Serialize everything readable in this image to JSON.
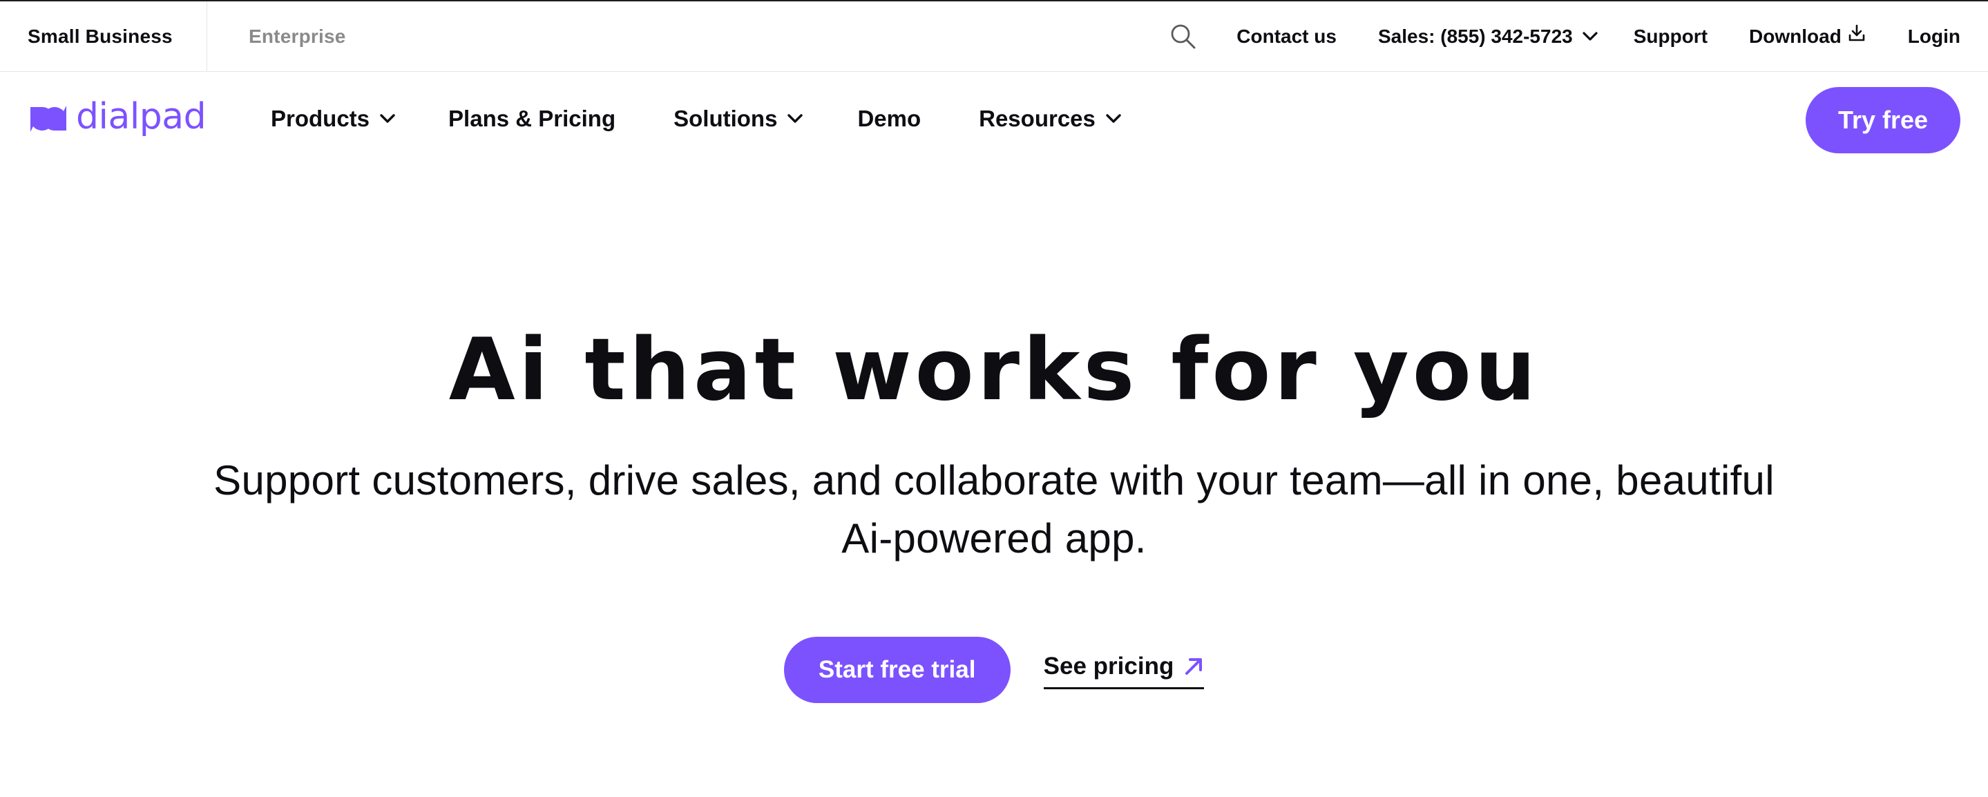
{
  "utility_bar": {
    "segments": [
      "Small Business",
      "Enterprise"
    ],
    "contact": "Contact us",
    "sales": "Sales: (855) 342-5723",
    "support": "Support",
    "download": "Download",
    "login": "Login"
  },
  "nav": {
    "logo_text": "dialpad",
    "items": [
      "Products",
      "Plans & Pricing",
      "Solutions",
      "Demo",
      "Resources"
    ],
    "cta": "Try free"
  },
  "hero": {
    "title": "Ai that works for you",
    "subtitle_line1": "Support customers, drive sales, and collaborate with your team—all in one, beautiful",
    "subtitle_line2": "Ai-powered app.",
    "primary_cta": "Start free trial",
    "secondary_cta": "See pricing"
  },
  "colors": {
    "brand": "#7c52ff",
    "text": "#0d0d12",
    "muted": "#8a8a8a"
  },
  "icons": [
    "search-icon",
    "chevron-down-icon",
    "download-icon",
    "logo-mark-icon",
    "arrow-up-right-icon"
  ]
}
